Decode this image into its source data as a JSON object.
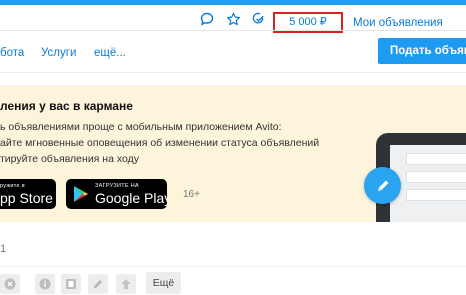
{
  "header": {
    "balance": "5 000 ₽",
    "my_ads": "Мои объявления",
    "icons": [
      "chat-icon",
      "star-icon",
      "notification-check-icon"
    ]
  },
  "nav": {
    "items": [
      "бота",
      "Услуги",
      "ещё..."
    ],
    "post_button": "Подать объявл"
  },
  "promo": {
    "title": "ления у вас в кармане",
    "lines": [
      "ь объявлениями проще с мобильным приложением Avito:",
      "айте мгновенные оповещения об изменении статуса объявлений",
      "тируйте объявления на ходу"
    ],
    "app_store": {
      "small": "ружите в",
      "big": "pp Store"
    },
    "google_play": {
      "small": "ЗАГРУЗИТЕ НА",
      "big": "Google Play"
    },
    "age": "16+",
    "colors": {
      "background": "#fdf4dc",
      "fab": "#2aa4ef"
    }
  },
  "list": {
    "count": "1",
    "more_label": "Ещё",
    "action_icons": [
      "close-icon",
      "info-icon",
      "promote-icon",
      "edit-icon",
      "raise-arrow-icon"
    ]
  },
  "colors": {
    "accent": "#1d9bf0",
    "link": "#0a7bd6",
    "balance_border": "#e02020"
  }
}
